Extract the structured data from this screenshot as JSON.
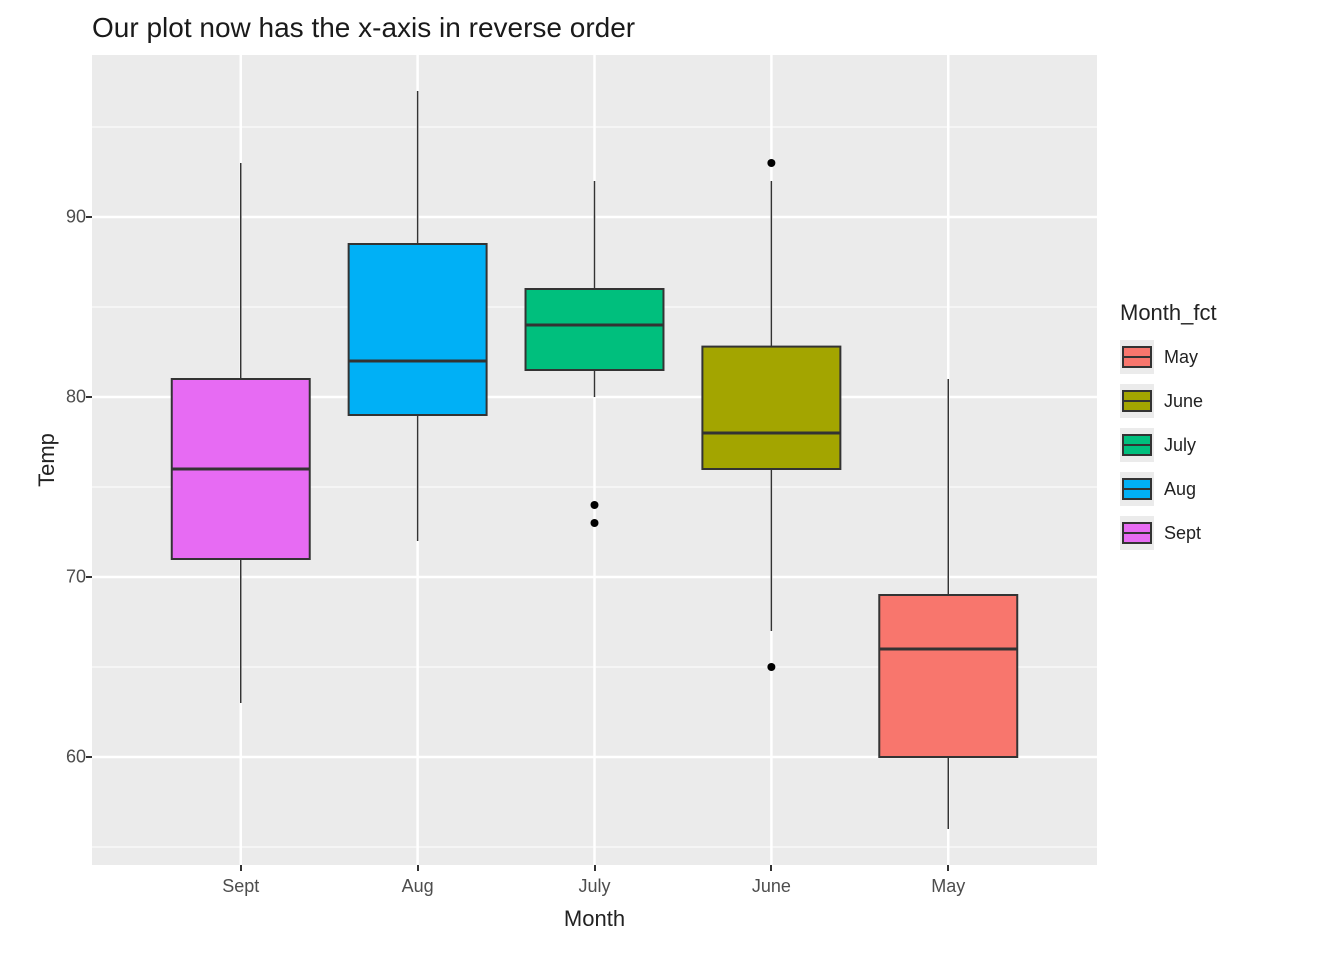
{
  "chart_data": {
    "type": "boxplot",
    "title": "Our plot now has the x-axis in reverse order",
    "xlabel": "Month",
    "ylabel": "Temp",
    "ylim": [
      54,
      99
    ],
    "y_ticks": [
      60,
      70,
      80,
      90
    ],
    "x_categories_display_order": [
      "Sept",
      "Aug",
      "July",
      "June",
      "May"
    ],
    "legend": {
      "title": "Month_fct",
      "items": [
        {
          "label": "May",
          "color": "#F8766D"
        },
        {
          "label": "June",
          "color": "#A3A500"
        },
        {
          "label": "July",
          "color": "#00BF7D"
        },
        {
          "label": "Aug",
          "color": "#00B0F6"
        },
        {
          "label": "Sept",
          "color": "#E76BF3"
        }
      ]
    },
    "series": [
      {
        "name": "Sept",
        "color": "#E76BF3",
        "min": 63,
        "q1": 71,
        "median": 76,
        "q3": 81,
        "max": 93,
        "outliers": []
      },
      {
        "name": "Aug",
        "color": "#00B0F6",
        "min": 72,
        "q1": 79,
        "median": 82,
        "q3": 88.5,
        "max": 97,
        "outliers": []
      },
      {
        "name": "July",
        "color": "#00BF7D",
        "min": 80,
        "q1": 81.5,
        "median": 84,
        "q3": 86,
        "max": 92,
        "outliers": [
          74,
          73
        ]
      },
      {
        "name": "June",
        "color": "#A3A500",
        "min": 67,
        "q1": 76,
        "median": 78,
        "q3": 82.8,
        "max": 92,
        "outliers": [
          93,
          65
        ]
      },
      {
        "name": "May",
        "color": "#F8766D",
        "min": 56,
        "q1": 60,
        "median": 66,
        "q3": 69,
        "max": 81,
        "outliers": []
      }
    ]
  }
}
